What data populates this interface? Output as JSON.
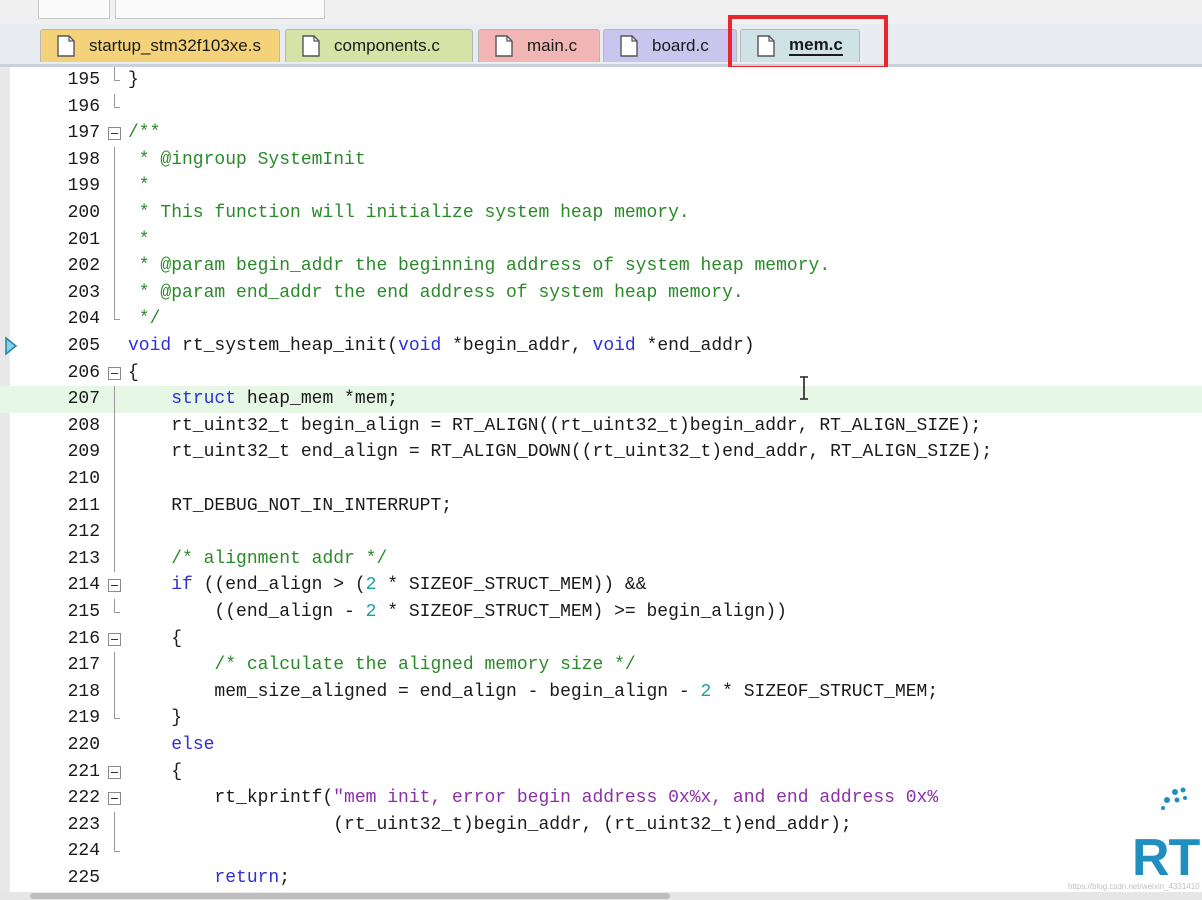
{
  "tabs": [
    {
      "label": "startup_stm32f103xe.s",
      "color": "#f3d27a",
      "active": false
    },
    {
      "label": "components.c",
      "color": "#d6e3a6",
      "active": false
    },
    {
      "label": "main.c",
      "color": "#f1b5b5",
      "active": false
    },
    {
      "label": "board.c",
      "color": "#c9c5ee",
      "active": false
    },
    {
      "label": "mem.c",
      "color": "#cfe3e6",
      "active": true
    }
  ],
  "editor": {
    "current_line": "207",
    "lines": [
      {
        "n": "195",
        "fold": "end",
        "code": [
          [
            "",
            "}"
          ]
        ]
      },
      {
        "n": "196",
        "fold": "end",
        "code": [
          [
            "",
            ""
          ]
        ]
      },
      {
        "n": "197",
        "fold": "box",
        "code": [
          [
            "cm",
            "/**"
          ]
        ]
      },
      {
        "n": "198",
        "fold": "line",
        "code": [
          [
            "cm",
            " * @ingroup SystemInit"
          ]
        ]
      },
      {
        "n": "199",
        "fold": "line",
        "code": [
          [
            "cm",
            " *"
          ]
        ]
      },
      {
        "n": "200",
        "fold": "line",
        "code": [
          [
            "cm",
            " * This function will initialize system heap memory."
          ]
        ]
      },
      {
        "n": "201",
        "fold": "line",
        "code": [
          [
            "cm",
            " *"
          ]
        ]
      },
      {
        "n": "202",
        "fold": "line",
        "code": [
          [
            "cm",
            " * @param begin_addr the beginning address of system heap memory."
          ]
        ]
      },
      {
        "n": "203",
        "fold": "line",
        "code": [
          [
            "cm",
            " * @param end_addr the end address of system heap memory."
          ]
        ]
      },
      {
        "n": "204",
        "fold": "end",
        "code": [
          [
            "cm",
            " */"
          ]
        ]
      },
      {
        "n": "205",
        "fold": "",
        "code": [
          [
            "kw",
            "void"
          ],
          [
            "",
            " rt_system_heap_init("
          ],
          [
            "kw",
            "void"
          ],
          [
            "",
            " *begin_addr, "
          ],
          [
            "kw",
            "void"
          ],
          [
            "",
            " *end_addr)"
          ]
        ]
      },
      {
        "n": "206",
        "fold": "box",
        "code": [
          [
            "",
            "{"
          ]
        ]
      },
      {
        "n": "207",
        "fold": "line",
        "code": [
          [
            "",
            "    "
          ],
          [
            "kw",
            "struct"
          ],
          [
            "",
            " heap_mem *mem;"
          ]
        ]
      },
      {
        "n": "208",
        "fold": "line",
        "code": [
          [
            "",
            "    rt_uint32_t begin_align = RT_ALIGN((rt_uint32_t)begin_addr, RT_ALIGN_SIZE);"
          ]
        ]
      },
      {
        "n": "209",
        "fold": "line",
        "code": [
          [
            "",
            "    rt_uint32_t end_align = RT_ALIGN_DOWN((rt_uint32_t)end_addr, RT_ALIGN_SIZE);"
          ]
        ]
      },
      {
        "n": "210",
        "fold": "line",
        "code": [
          [
            "",
            ""
          ]
        ]
      },
      {
        "n": "211",
        "fold": "line",
        "code": [
          [
            "",
            "    RT_DEBUG_NOT_IN_INTERRUPT;"
          ]
        ]
      },
      {
        "n": "212",
        "fold": "line",
        "code": [
          [
            "",
            ""
          ]
        ]
      },
      {
        "n": "213",
        "fold": "line",
        "code": [
          [
            "",
            "    "
          ],
          [
            "cm",
            "/* alignment addr */"
          ]
        ]
      },
      {
        "n": "214",
        "fold": "box",
        "code": [
          [
            "",
            "    "
          ],
          [
            "kw",
            "if"
          ],
          [
            "",
            " ((end_align > ("
          ],
          [
            "num",
            "2"
          ],
          [
            "",
            " * SIZEOF_STRUCT_MEM)) &&"
          ]
        ]
      },
      {
        "n": "215",
        "fold": "end",
        "code": [
          [
            "",
            "        ((end_align - "
          ],
          [
            "num",
            "2"
          ],
          [
            "",
            " * SIZEOF_STRUCT_MEM) >= begin_align))"
          ]
        ]
      },
      {
        "n": "216",
        "fold": "box",
        "code": [
          [
            "",
            "    {"
          ]
        ]
      },
      {
        "n": "217",
        "fold": "line",
        "code": [
          [
            "",
            "        "
          ],
          [
            "cm",
            "/* calculate the aligned memory size */"
          ]
        ]
      },
      {
        "n": "218",
        "fold": "line",
        "code": [
          [
            "",
            "        mem_size_aligned = end_align - begin_align - "
          ],
          [
            "num",
            "2"
          ],
          [
            "",
            " * SIZEOF_STRUCT_MEM;"
          ]
        ]
      },
      {
        "n": "219",
        "fold": "end",
        "code": [
          [
            "",
            "    }"
          ]
        ]
      },
      {
        "n": "220",
        "fold": "",
        "code": [
          [
            "",
            "    "
          ],
          [
            "kw",
            "else"
          ]
        ]
      },
      {
        "n": "221",
        "fold": "box",
        "code": [
          [
            "",
            "    {"
          ]
        ]
      },
      {
        "n": "222",
        "fold": "box",
        "code": [
          [
            "",
            "        rt_kprintf("
          ],
          [
            "str",
            "\"mem init, error begin address 0x%x, and end address 0x%"
          ]
        ]
      },
      {
        "n": "223",
        "fold": "line",
        "code": [
          [
            "",
            "                   (rt_uint32_t)begin_addr, (rt_uint32_t)end_addr);"
          ]
        ]
      },
      {
        "n": "224",
        "fold": "end",
        "code": [
          [
            "",
            ""
          ]
        ]
      },
      {
        "n": "225",
        "fold": "",
        "code": [
          [
            "",
            "        "
          ],
          [
            "kw",
            "return"
          ],
          [
            "",
            ";"
          ]
        ]
      }
    ]
  },
  "logo": {
    "text": "RT",
    "name": "rt-thread-logo"
  },
  "watermark": "https://blog.csdn.net/weixin_4331410",
  "colors": {
    "highlight": "#e8262b",
    "keyword": "#2f2fd6",
    "comment": "#2a8a2a",
    "string": "#8b2fa8",
    "number": "#1aa0a0"
  }
}
